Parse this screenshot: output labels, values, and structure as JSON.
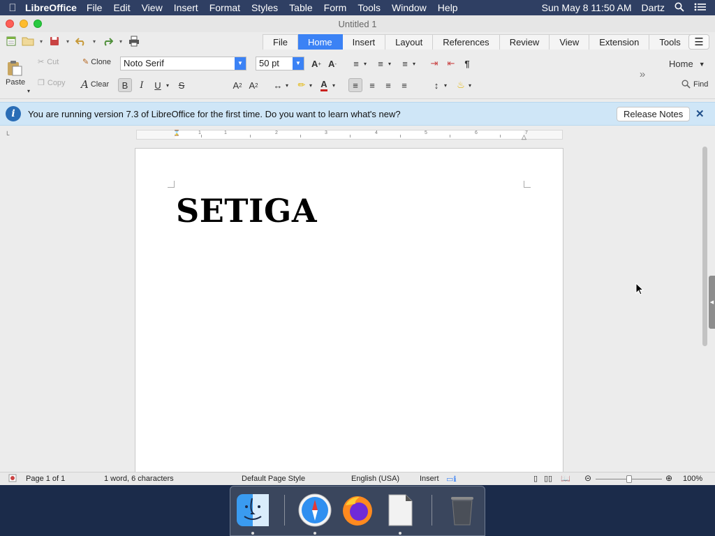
{
  "menubar": {
    "app": "LibreOffice",
    "items": [
      "File",
      "Edit",
      "View",
      "Insert",
      "Format",
      "Styles",
      "Table",
      "Form",
      "Tools",
      "Window",
      "Help"
    ],
    "datetime": "Sun May 8  11:50 AM",
    "user": "Dartz"
  },
  "window": {
    "title": "Untitled 1"
  },
  "tabs": [
    "File",
    "Home",
    "Insert",
    "Layout",
    "References",
    "Review",
    "View",
    "Extension",
    "Tools"
  ],
  "active_tab": "Home",
  "ribbon": {
    "paste": "Paste",
    "cut": "Cut",
    "copy": "Copy",
    "clone": "Clone",
    "clear": "Clear",
    "font_name": "Noto Serif",
    "font_size": "50 pt",
    "home_dropdown": "Home",
    "find": "Find",
    "bold": "B",
    "italic": "I",
    "underline": "U",
    "strike": "S"
  },
  "infobar": {
    "message": "You are running version 7.3 of LibreOffice for the first time. Do you want to learn what's new?",
    "button": "Release Notes"
  },
  "ruler_numbers": [
    "1",
    "1",
    "2",
    "3",
    "4",
    "5",
    "6",
    "7"
  ],
  "document": {
    "text": "SETIGA"
  },
  "statusbar": {
    "page": "Page 1 of 1",
    "words": "1 word, 6 characters",
    "page_style": "Default Page Style",
    "language": "English (USA)",
    "mode": "Insert",
    "zoom": "100%"
  },
  "colors": {
    "accent": "#3b82f5",
    "infobar_bg": "#cfe6f7",
    "menubar_bg": "#2f3f63"
  }
}
